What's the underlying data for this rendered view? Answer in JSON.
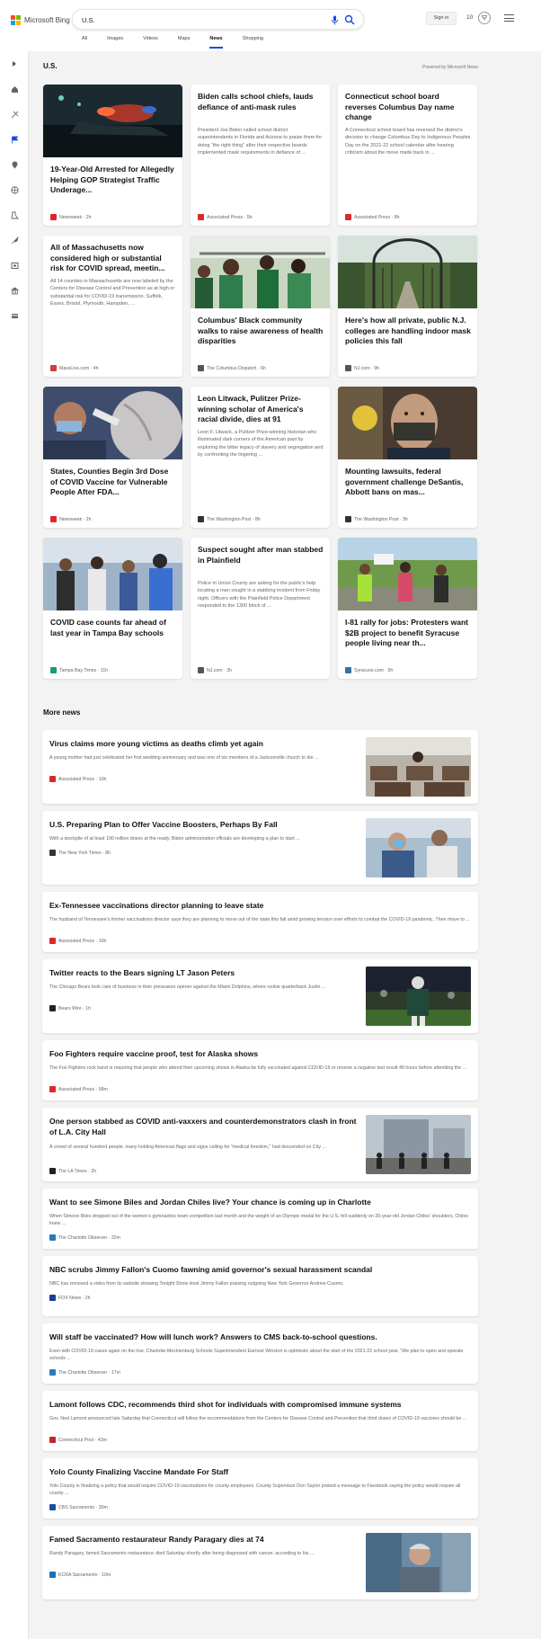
{
  "header": {
    "brand": "Microsoft Bing",
    "query": "U.S.",
    "signin": "Sign in",
    "points": "10",
    "tabs": [
      "All",
      "Images",
      "Videos",
      "Maps",
      "News",
      "Shopping"
    ],
    "active_tab": "News"
  },
  "sidebar": {
    "icons": [
      "expand-icon",
      "home-icon",
      "discover-icon",
      "flag-icon",
      "location-icon",
      "globe-icon",
      "science-icon",
      "rocket-icon",
      "entertainment-icon",
      "money-icon",
      "card-icon"
    ]
  },
  "section": {
    "title": "U.S.",
    "powered": "Powered by Microsoft News"
  },
  "cards": [
    {
      "title": "19-Year-Old Arrested for Allegedly Helping GOP Strategist Traffic Underage...",
      "source": "Newsweek",
      "age": "2h",
      "logo_color": "#e0262d",
      "image": "police-lights"
    },
    {
      "title": "Biden calls school chiefs, lauds defiance of anti-mask rules",
      "snippet": "President Joe Biden called school district superintendents in Florida and Arizona to praise them for doing “the right thing” after their respective boards implemented mask requirements in defiance of ...",
      "source": "Associated Press",
      "age": "5h",
      "logo_color": "#e0262d"
    },
    {
      "title": "Connecticut school board reverses Columbus Day name change",
      "snippet": "A Connecticut school board has reversed the district’s decision to change Columbus Day to Indigenous Peoples Day on the 2021-22 school calendar after hearing criticism about the move made back in ...",
      "source": "Associated Press",
      "age": "8h",
      "logo_color": "#e0262d"
    },
    {
      "title": "All of Massachusetts now considered high or substantial risk for COVID spread, meetin...",
      "snippet": "All 14 counties in Massachusetts are now labeled by the Centers for Disease Control and Prevention as at high or substantial risk for COVID-19 transmission. Suffolk, Essex, Bristol, Plymouth, Hampden, ...",
      "source": "MassLive.com",
      "age": "4h",
      "logo_color": "#d23c3c"
    },
    {
      "title": "Columbus' Black community walks to raise awareness of health disparities",
      "source": "The Columbus Dispatch",
      "age": "6h",
      "logo_color": "#555555",
      "image": "crowd-walk"
    },
    {
      "title": "Here's how all private, public N.J. colleges are handling indoor mask policies this fall",
      "source": "NJ.com",
      "age": "9h",
      "logo_color": "#555555",
      "image": "campus-gate"
    },
    {
      "title": "States, Counties Begin 3rd Dose of COVID Vaccine for Vulnerable People After FDA...",
      "source": "Newsweek",
      "age": "2h",
      "logo_color": "#e0262d",
      "image": "vaccine-shot"
    },
    {
      "title": "Leon Litwack, Pulitzer Prize-winning scholar of America's racial divide, dies at 91",
      "snippet": "Leon F. Litwack, a Pulitzer Prize-winning historian who illuminated dark corners of the American past by exploring the bitter legacy of slavery and segregation and by confronting the lingering ...",
      "source": "The Washington Post",
      "age": "8h",
      "logo_color": "#333333"
    },
    {
      "title": "Mounting lawsuits, federal government challenge DeSantis, Abbott bans on mas...",
      "source": "The Washington Post",
      "age": "3h",
      "logo_color": "#333333",
      "image": "masked-man"
    },
    {
      "title": "COVID case counts far ahead of last year in Tampa Bay schools",
      "source": "Tampa Bay Times",
      "age": "11h",
      "logo_color": "#1b9c6b",
      "image": "students"
    },
    {
      "title": "Suspect sought after man stabbed in Plainfield",
      "snippet": "Police in Union County are asking for the public’s help locating a man sought in a stabbing incident from Friday night. Officers with the Plainfield Police Department responded to the 1300 block of ...",
      "source": "NJ.com",
      "age": "3h",
      "logo_color": "#555555"
    },
    {
      "title": "I-81 rally for jobs: Protesters want $2B project to benefit Syracuse people living near th...",
      "source": "Syracuse.com",
      "age": "5h",
      "logo_color": "#3a6ea5",
      "image": "rally"
    }
  ],
  "more_news": {
    "title": "More news",
    "items": [
      {
        "title": "Virus claims more young victims as deaths climb yet again",
        "snippet": "A young mother had just celebrated her first wedding anniversary and was one of six members of a Jacksonville church to die ...",
        "source": "Associated Press",
        "age": "10h",
        "logo_color": "#e0262d",
        "image": "church-pews"
      },
      {
        "title": "U.S. Preparing Plan to Offer Vaccine Boosters, Perhaps By Fall",
        "snippet": "With a stockpile of at least 100 million doses at the ready, Biden administration officials are developing a plan to start ...",
        "source": "The New York Times",
        "age": "8h",
        "logo_color": "#333333",
        "image": "vaccination"
      },
      {
        "title": "Ex-Tennessee vaccinations director planning to leave state",
        "snippet": "The husband of Tennessee's former vaccinations director says they are planning to move out of the state this fall amid growing tension over efforts to combat the COVID-19 pandemic. Their move to ...",
        "source": "Associated Press",
        "age": "10h",
        "logo_color": "#e0262d"
      },
      {
        "title": "Twitter reacts to the Bears signing LT Jason Peters",
        "snippet": "The Chicago Bears took care of business in their preseason opener against the Miami Dolphins, where rookie quarterback Justin ...",
        "source": "Bears Wire",
        "age": "1h",
        "logo_color": "#222222",
        "image": "football-player"
      },
      {
        "title": "Foo Fighters require vaccine proof, test for Alaska shows",
        "snippet": "The Foo Fighters rock band is requiring that people who attend their upcoming shows in Alaska be fully vaccinated against COVID-19 or receive a negative test result 48 hours before attending the ...",
        "source": "Associated Press",
        "age": "58m",
        "logo_color": "#e0262d"
      },
      {
        "title": "One person stabbed as COVID anti-vaxxers and counterdemonstrators clash in front of L.A. City Hall",
        "snippet": "A crowd of several hundred people, many holding American flags and signs calling for \"medical freedom,\" had descended on City ...",
        "source": "The LA Times",
        "age": "2h",
        "logo_color": "#222222",
        "image": "city-hall"
      },
      {
        "title": "Want to see Simone Biles and Jordan Chiles live? Your chance is coming up in Charlotte",
        "snippet": "When Simone Biles dropped out of the women’s gymnastics team competition last month and the weight of an Olympic medal for the U.S. fell suddenly on 20-year-old Jordan Chiles’ shoulders, Chiles knew ...",
        "source": "The Charlotte Observer",
        "age": "32m",
        "logo_color": "#2a7ab8"
      },
      {
        "title": "NBC scrubs Jimmy Fallon's Cuomo fawning amid governor's sexual harassment scandal",
        "snippet": "NBC has removed a video from its website showing Tonight Show Host Jimmy Fallon praising outgoing New York Governor Andrew Cuomo.",
        "source": "FOX News",
        "age": "2h",
        "logo_color": "#1c3f94"
      },
      {
        "title": "Will staff be vaccinated? How will lunch work? Answers to CMS back-to-school questions.",
        "snippet": "Even with COVID-19 cases again on the rise, Charlotte-Mecklenburg Schools Superintendent Earnest Winston is optimistic about the start of the 2021-22 school year. “We plan to open and operate schools ...",
        "source": "The Charlotte Observer",
        "age": "17m",
        "logo_color": "#2a7ab8"
      },
      {
        "title": "Lamont follows CDC, recommends third shot for individuals with compromised immune systems",
        "snippet": "Gov. Ned Lamont announced late Saturday that Connecticut will follow the recommendations from the Centers for Disease Control and Prevention that third doses of COVID-19 vaccines should be ...",
        "source": "Connecticut Post",
        "age": "43m",
        "logo_color": "#c0282d"
      },
      {
        "title": "Yolo County Finalizing Vaccine Mandate For Staff",
        "snippet": "Yolo County is finalizing a policy that would require COVID-19 vaccinations for county employees. County Supervisor Don Saylor posted a message to Facebook saying the policy would require all county ...",
        "source": "CBS Sacramento",
        "age": "30m",
        "logo_color": "#1d4fa0"
      },
      {
        "title": "Famed Sacramento restaurateur Randy Paragary dies at 74",
        "snippet": "Randy Paragary, famed Sacramento restaurateur, died Saturday shortly after being diagnosed with cancer, according to his ...",
        "source": "KCRA Sacramento",
        "age": "10m",
        "logo_color": "#1a6fc4",
        "image": "portrait"
      }
    ]
  }
}
